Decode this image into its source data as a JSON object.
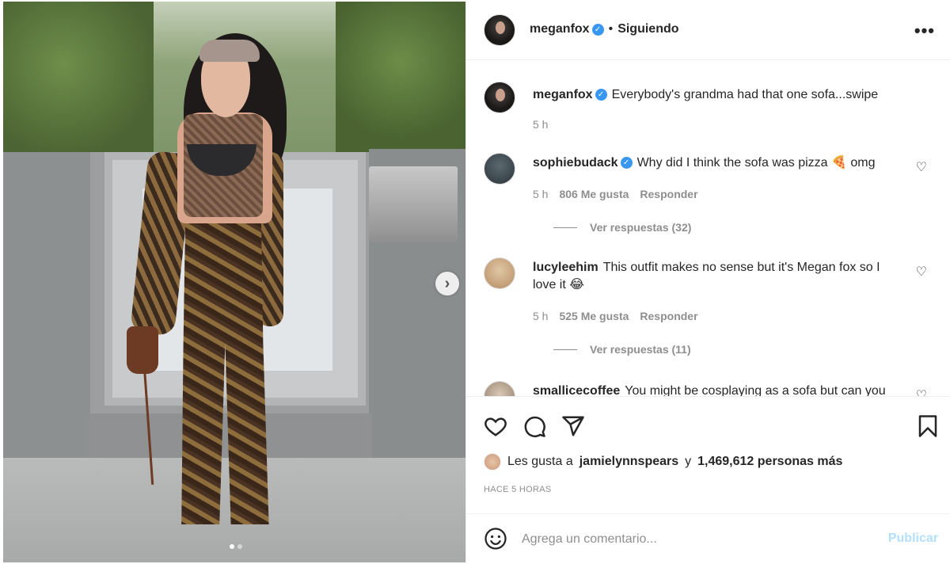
{
  "post": {
    "carousel_position": 1,
    "carousel_total": 2
  },
  "header": {
    "username": "meganfox",
    "separator": "•",
    "follow_status": "Siguiendo",
    "more_icon": "more-horizontal-icon"
  },
  "caption": {
    "username": "meganfox",
    "text": "Everybody's grandma had that one sofa...swipe",
    "time": "5 h"
  },
  "comments": [
    {
      "username": "sophiebudack",
      "verified": true,
      "text": "Why did I think the sofa was pizza 🍕 omg",
      "time": "5 h",
      "likes": "806 Me gusta",
      "reply": "Responder",
      "view_replies": "Ver respuestas (32)"
    },
    {
      "username": "lucyleehim",
      "verified": false,
      "text": "This outfit makes no sense but it's Megan fox so I love it 😂",
      "time": "5 h",
      "likes": "525 Me gusta",
      "reply": "Responder",
      "view_replies": "Ver respuestas (11)"
    },
    {
      "username": "smallicecoffee",
      "verified": false,
      "text": "You might be cosplaying as a sofa but can you"
    }
  ],
  "likes": {
    "prefix": "Les gusta a",
    "user": "jamielynnspears",
    "joiner": "y",
    "others": "1,469,612 personas más"
  },
  "timestamp": "HACE 5 HORAS",
  "comment_box": {
    "placeholder": "Agrega un comentario...",
    "publish": "Publicar"
  },
  "colors": {
    "verified": "#3897f0",
    "publish_disabled": "#b2dffc",
    "muted": "#8e8e8e"
  }
}
